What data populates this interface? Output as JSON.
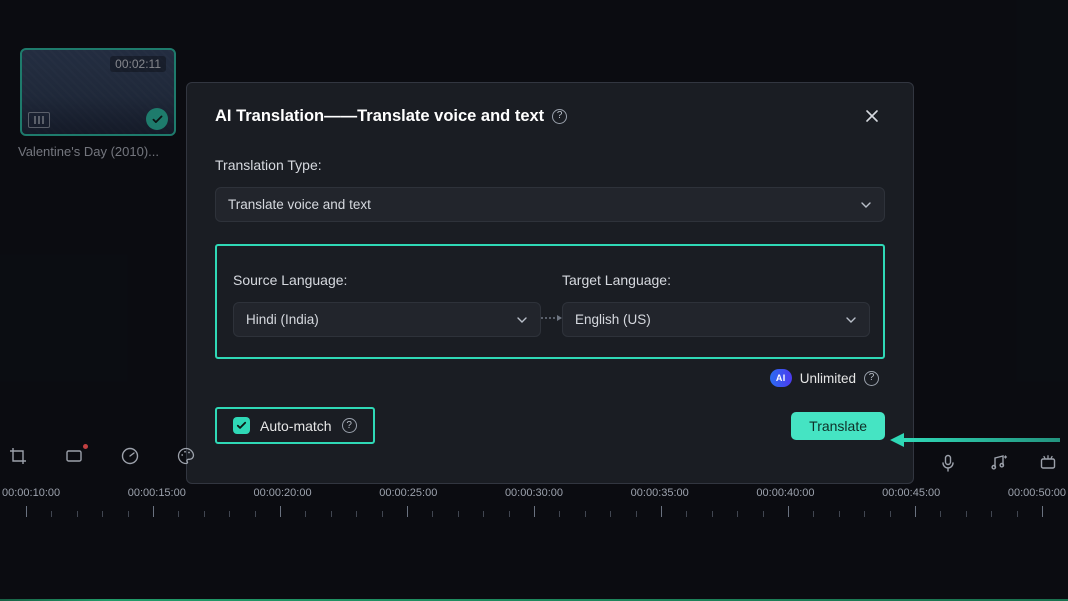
{
  "media": {
    "duration": "00:02:11",
    "clip_name": "Valentine's Day (2010)..."
  },
  "dialog": {
    "title": "AI Translation——Translate voice and text",
    "translation_type_label": "Translation Type:",
    "translation_type_value": "Translate voice and text",
    "source_label": "Source Language:",
    "source_value": "Hindi (India)",
    "target_label": "Target Language:",
    "target_value": "English (US)",
    "ai_badge": "AI",
    "unlimited_label": "Unlimited",
    "automatch_label": "Auto-match",
    "translate_button": "Translate"
  },
  "timeline": {
    "labels": [
      "00:00:10:00",
      "00:00:15:00",
      "00:00:20:00",
      "00:00:25:00",
      "00:00:30:00",
      "00:00:35:00",
      "00:00:40:00",
      "00:00:45:00",
      "00:00:50:00"
    ]
  },
  "icons": {
    "crop": "crop-icon",
    "square": "aspect-icon",
    "speed": "speed-icon",
    "palette": "palette-icon",
    "mic": "mic-icon",
    "music": "music-icon",
    "effects": "effects-icon"
  }
}
